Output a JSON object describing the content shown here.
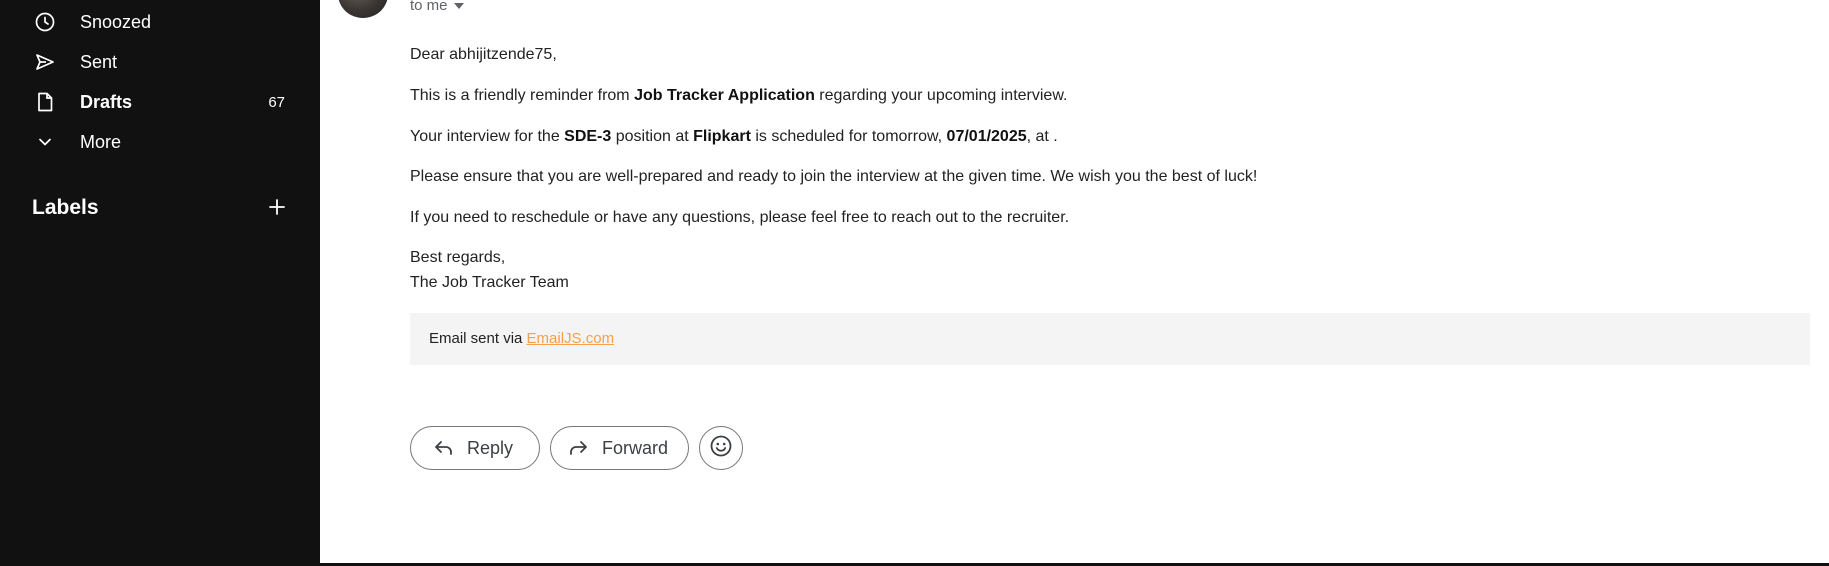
{
  "sidebar": {
    "items": [
      {
        "label": "Snoozed",
        "icon": "clock-icon"
      },
      {
        "label": "Sent",
        "icon": "send-icon"
      },
      {
        "label": "Drafts",
        "icon": "draft-icon",
        "count": "67"
      },
      {
        "label": "More",
        "icon": "chevron-down-icon"
      }
    ],
    "labels_header": "Labels"
  },
  "email": {
    "recipient": "to me",
    "greeting": "Dear abhijitzende75,",
    "p1": {
      "pre": "This is a friendly reminder from ",
      "bold": "Job Tracker Application",
      "post": " regarding your upcoming interview."
    },
    "p2": {
      "pre": "Your interview for the ",
      "role": "SDE-3",
      "mid1": " position at ",
      "company": "Flipkart",
      "mid2": " is scheduled for tomorrow, ",
      "date": "07/01/2025",
      "post": ", at ."
    },
    "p3": "Please ensure that you are well-prepared and ready to join the interview at the given time. We wish you the best of luck!",
    "p4": "If you need to reschedule or have any questions, please feel free to reach out to the recruiter.",
    "closing": "Best regards,",
    "signature": "The Job Tracker Team",
    "footer": {
      "text": "Email sent via ",
      "link": "EmailJS.com"
    }
  },
  "actions": {
    "reply_label": "Reply",
    "forward_label": "Forward"
  },
  "colors": {
    "sidebar_bg": "#111111",
    "link": "#f5a04a",
    "footer_bg": "#f4f4f4"
  }
}
